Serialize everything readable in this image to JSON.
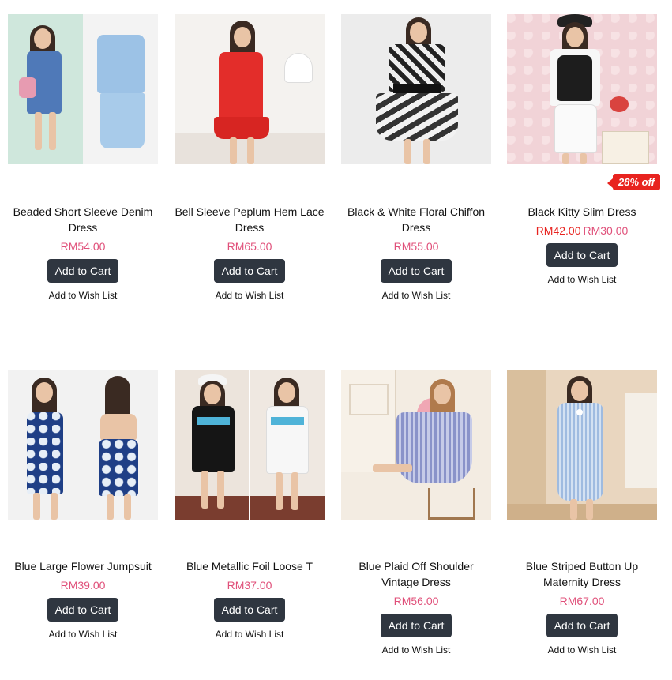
{
  "products": [
    {
      "title": "Beaded Short Sleeve Denim Dress",
      "price": "RM54.00",
      "cart": "Add to Cart",
      "wish": "Add to Wish List"
    },
    {
      "title": "Bell Sleeve Peplum Hem Lace Dress",
      "price": "RM65.00",
      "cart": "Add to Cart",
      "wish": "Add to Wish List"
    },
    {
      "title": "Black & White Floral Chiffon Dress",
      "price": "RM55.00",
      "cart": "Add to Cart",
      "wish": "Add to Wish List"
    },
    {
      "title": "Black Kitty Slim Dress",
      "old_price": "RM42.00",
      "price": "RM30.00",
      "badge": "28% off",
      "cart": "Add to Cart",
      "wish": "Add to Wish List"
    },
    {
      "title": "Blue Large Flower Jumpsuit",
      "price": "RM39.00",
      "cart": "Add to Cart",
      "wish": "Add to Wish List"
    },
    {
      "title": "Blue Metallic Foil Loose T",
      "price": "RM37.00",
      "cart": "Add to Cart",
      "wish": "Add to Wish List"
    },
    {
      "title": "Blue Plaid Off Shoulder Vintage Dress",
      "price": "RM56.00",
      "cart": "Add to Cart",
      "wish": "Add to Wish List"
    },
    {
      "title": "Blue Striped Button Up Maternity Dress",
      "price": "RM67.00",
      "cart": "Add to Cart",
      "wish": "Add to Wish List"
    }
  ],
  "colors": {
    "price": "#e0507a",
    "old_price": "#e8231f",
    "button": "#2f3640",
    "badge": "#e8231f"
  }
}
